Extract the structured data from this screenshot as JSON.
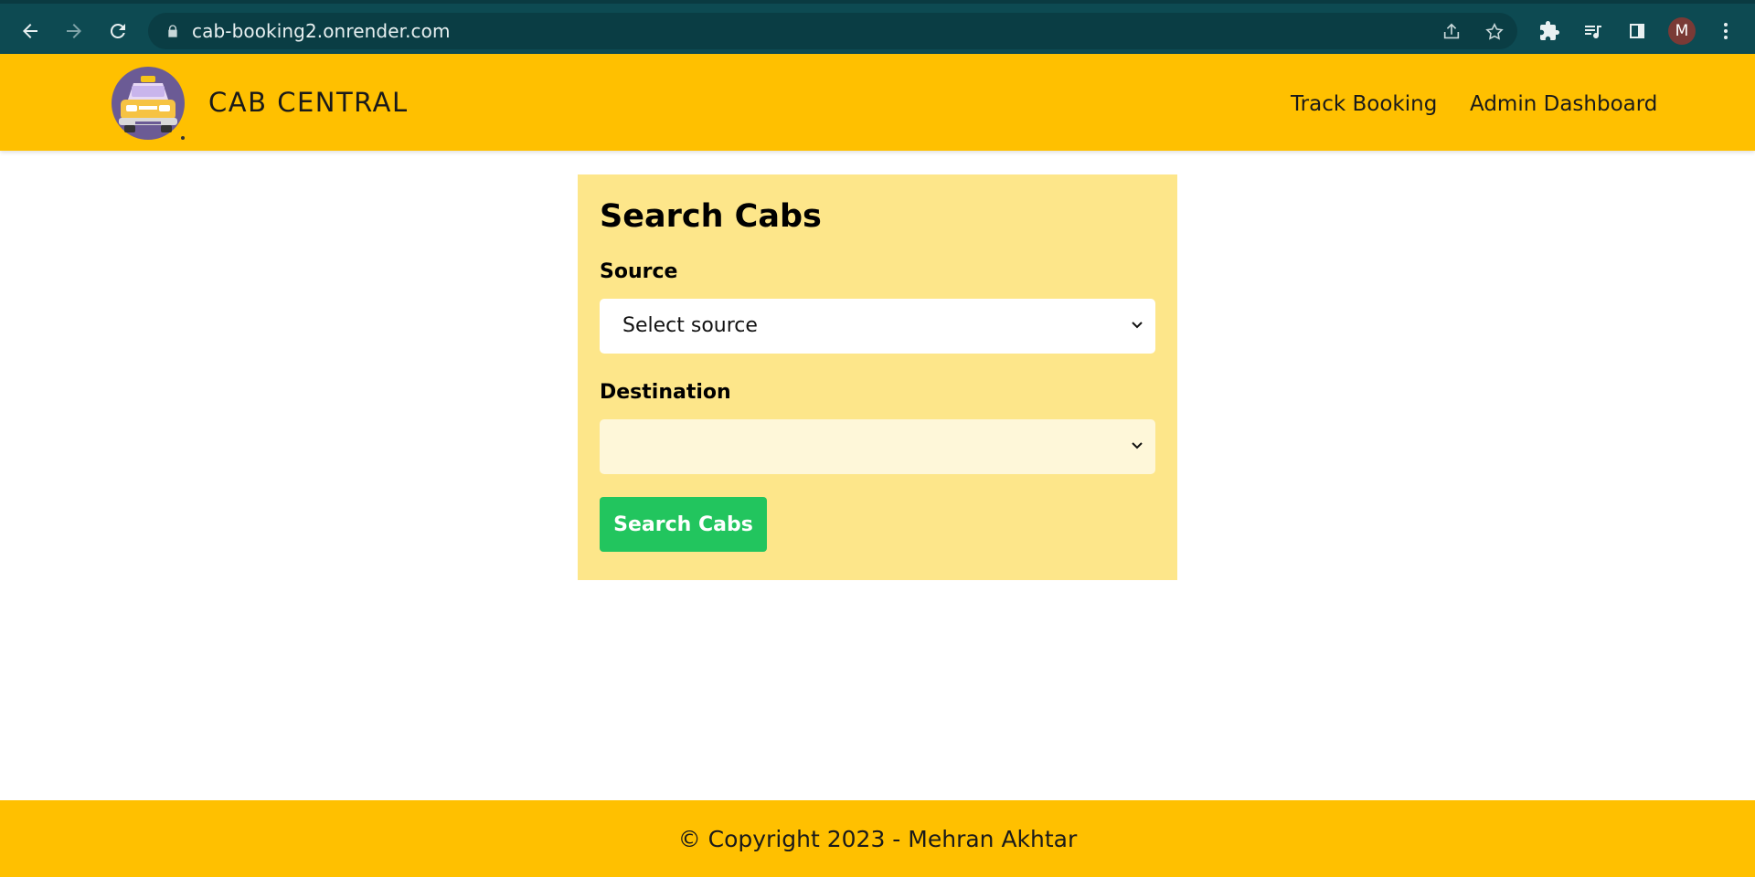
{
  "browser": {
    "url": "cab-booking2.onrender.com",
    "profile_initial": "M",
    "icons": [
      "back-icon",
      "forward-icon",
      "reload-icon",
      "lock-icon",
      "share-icon",
      "star-icon",
      "puzzle-icon",
      "media-icon",
      "sidepanel-icon",
      "kebab-menu-icon"
    ]
  },
  "header": {
    "brand": "CAB CENTRAL",
    "nav": [
      "Track Booking",
      "Admin Dashboard"
    ],
    "color": "#ffc000"
  },
  "search": {
    "title": "Search Cabs",
    "source_label": "Source",
    "source_value": "Select source",
    "destination_label": "Destination",
    "destination_value": "",
    "button_label": "Search Cabs",
    "card_color": "#fde68a",
    "button_color": "#22c55e"
  },
  "footer": {
    "text": "© Copyright 2023 - Mehran Akhtar"
  }
}
